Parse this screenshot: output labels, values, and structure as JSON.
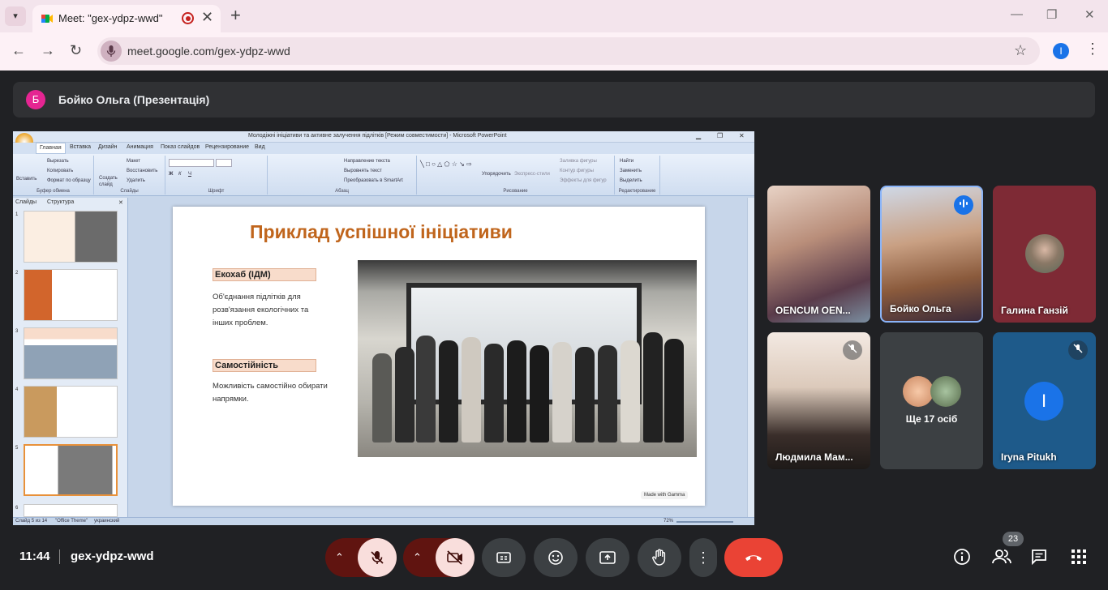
{
  "browser": {
    "tab_title": "Meet: \"gex-ydpz-wwd\"",
    "tab_close": "✕",
    "new_tab": "+",
    "window_controls": [
      "—",
      "❐",
      "✕"
    ],
    "url": "meet.google.com/gex-ydpz-wwd",
    "profile_initial": "I"
  },
  "presenter_bar": {
    "avatar_initial": "Б",
    "name": "Бойко Ольга (Презентація)",
    "avatar_color": "#e52592"
  },
  "powerpoint": {
    "window_title": "Молодіжні ініціативи та активне залучення підлітків [Режим совместимости] - Microsoft PowerPoint",
    "ribbon_tabs": [
      "Главная",
      "Вставка",
      "Дизайн",
      "Анимация",
      "Показ слайдов",
      "Рецензирование",
      "Вид"
    ],
    "ribbon_groups": [
      "Буфер обмена",
      "Слайды",
      "Шрифт",
      "Абзац",
      "Рисование",
      "Редактирование"
    ],
    "clipboard_items": [
      "Вырезать",
      "Копировать",
      "Формат по образцу"
    ],
    "slides_items": [
      "Макет",
      "Восстановить",
      "Удалить"
    ],
    "paragraph_items": [
      "Направление текста",
      "Выровнять текст",
      "Преобразовать в SmartArt"
    ],
    "drawing_items": [
      "Заливка фигуры",
      "Контур фигуры",
      "Эффекты для фигур"
    ],
    "editing_items": [
      "Найти",
      "Заменить",
      "Выделить"
    ],
    "create_slide_label": "Создать слайд",
    "paste_label": "Вставить",
    "arrange_label": "Упорядочить",
    "quick_styles_label": "Экспресс-стили",
    "left_panel_tabs": [
      "Слайды",
      "Структура"
    ],
    "thumbnail_numbers": [
      "1",
      "2",
      "3",
      "4",
      "5",
      "6"
    ],
    "status_left": "Слайд 5 из 14",
    "status_theme": "\"Office Theme\"",
    "status_lang": "украинский",
    "status_zoom": "72%"
  },
  "slide": {
    "title": "Приклад успішної ініціативи",
    "label1": "Екохаб (ІДМ)",
    "text1": "Об'єднання підлітків для розв'язання екологічних та інших проблем.",
    "label2": "Самостійність",
    "text2": "Можливість самостійно обирати напрямки.",
    "made_with": "Made with Gamma"
  },
  "participants": [
    {
      "name": "OENCUM OEN...",
      "muted": false
    },
    {
      "name": "Бойко Ольга",
      "muted": false,
      "speaking": true
    },
    {
      "name": "Галина Ганзій",
      "muted": false
    },
    {
      "name": "Людмила Мам...",
      "muted": true
    },
    {
      "name": "Ще 17 осіб",
      "muted": false
    },
    {
      "name": "Iryna Pitukh",
      "muted": true,
      "initial": "I"
    }
  ],
  "bottom_bar": {
    "time": "11:44",
    "meeting_code": "gex-ydpz-wwd",
    "participants_count": "23"
  },
  "colors": {
    "meet_bg": "#202124",
    "end_call": "#ea4335",
    "slide_title": "#c0651c",
    "muted_btn_bg": "#f9dedc"
  }
}
